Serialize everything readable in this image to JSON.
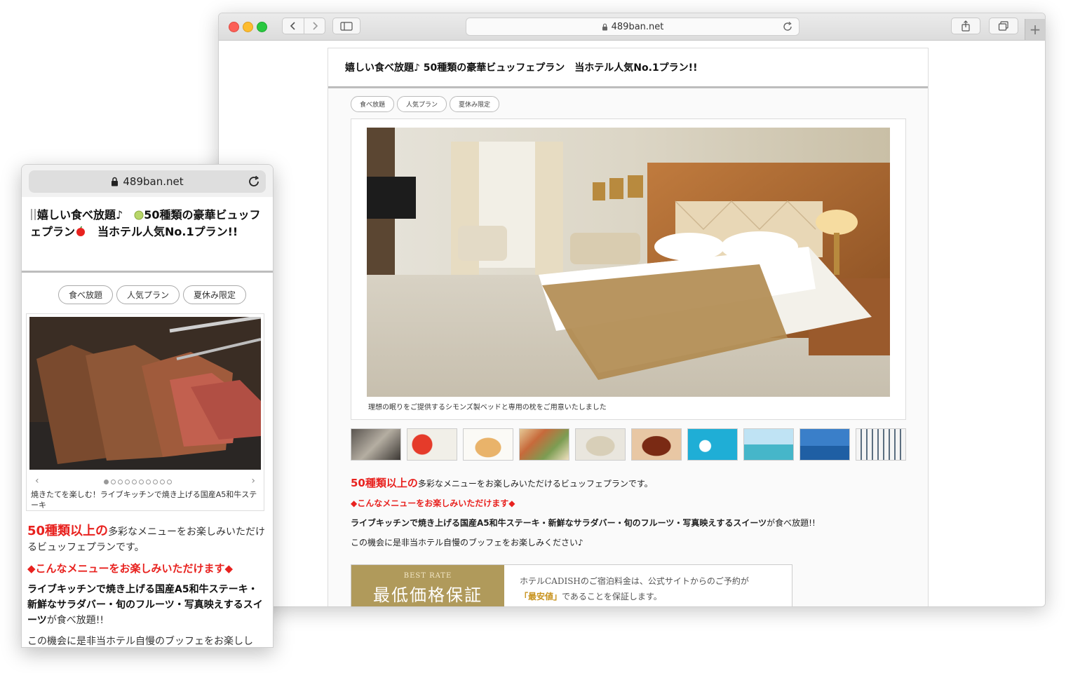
{
  "desktop": {
    "address": "489ban.net",
    "page_title": "嬉しい食べ放題♪ 50種類の豪華ビュッフェプラン　当ホテル人気No.1プラン!!",
    "tags": [
      "食べ放題",
      "人気プラン",
      "夏休み限定"
    ],
    "caption": "理想の眠りをご提供するシモンズ製ベッドと専用の枕をご用意いたしました",
    "intro_highlight": "50種類以上の",
    "intro_rest": "多彩なメニューをお楽しみいただけるビュッフェプランです。",
    "menu_heading": "◆こんなメニューをお楽しみいただけます◆",
    "menu_list": "ライブキッチンで焼き上げる国産A5和牛ステーキ・新鮮なサラダバー・旬のフルーツ・写真映えするスイーツ",
    "menu_list_suffix": "が食べ放題!!",
    "closing": "この機会に是非当ホテル自慢のブッフェをお楽しみください♪",
    "rate_small": "BEST RATE",
    "rate_big": "最低価格保証",
    "rate_line1": "ホテルCADISHのご宿泊料金は、公式サイトからのご予約が",
    "rate_line2_hi": "「最安値」",
    "rate_line2_rest": "であることを保証します。"
  },
  "mobile": {
    "address": "489ban.net",
    "title_part1": "嬉しい食べ放題♪　",
    "title_part2": "50種類の豪華ビュッフェプラン",
    "title_part3": "　当ホテル人気No.1プラン!!",
    "tags": [
      "食べ放題",
      "人気プラン",
      "夏休み限定"
    ],
    "caption": "焼きたてを楽しむ！ライブキッチンで焼き上げる国産A5和牛ステーキ",
    "intro_highlight": "50種類以上の",
    "intro_rest": "多彩なメニューをお楽しみいただけるビュッフェプランです。",
    "menu_heading": "◆こんなメニューをお楽しみいただけます◆",
    "menu_list": "ライブキッチンで焼き上げる国産A5和牛ステーキ・新鮮なサラダバー・旬のフルーツ・写真映えするスイーツ",
    "menu_list_suffix": "が食べ放題!!",
    "closing": "この機会に是非当ホテル自慢のブッフェをお楽しし"
  },
  "colors": {
    "accent_red": "#e8221f",
    "gold": "#b09a5b"
  },
  "icons": {
    "lock": "lock-icon",
    "reload": "reload-icon",
    "back": "chevron-left-icon",
    "forward": "chevron-right-icon",
    "sidebar": "sidebar-icon",
    "share": "share-icon",
    "tabs": "tabs-icon",
    "new_tab": "plus-icon"
  },
  "new_tab_glyph": "+",
  "slider": {
    "dot_count": 10,
    "active_dot": 0,
    "prev_glyph": "‹",
    "next_glyph": "›"
  }
}
